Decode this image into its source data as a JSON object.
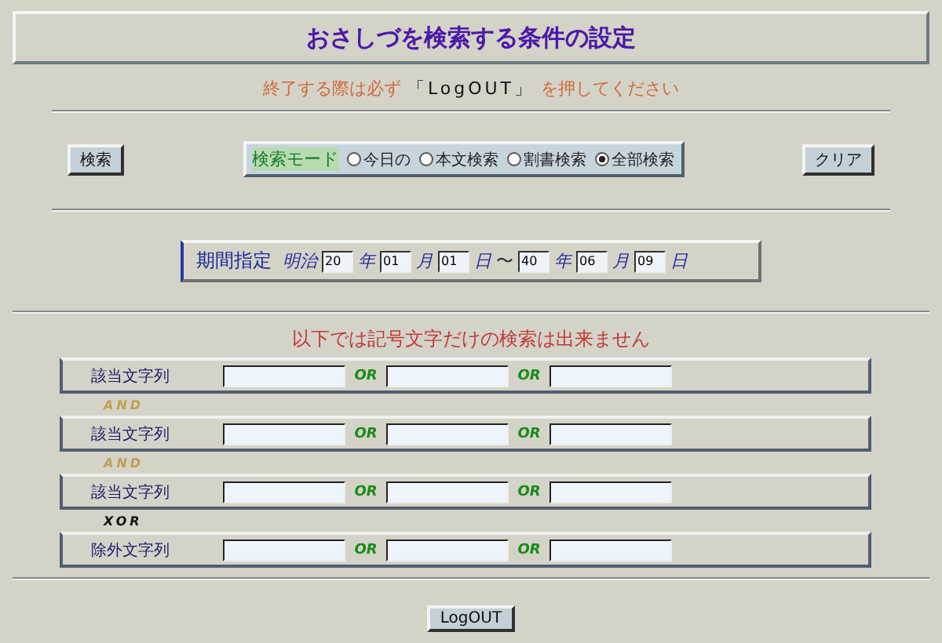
{
  "title": "おさしづを検索する条件の設定",
  "notice": {
    "before": "終了する際は必ず",
    "emphasis": "「LogOUT」",
    "after": "を押してください"
  },
  "search_button": "検索",
  "clear_button": "クリア",
  "mode": {
    "label": "検索モード",
    "options": [
      {
        "label": "今日の",
        "selected": false
      },
      {
        "label": "本文検索",
        "selected": false
      },
      {
        "label": "割書検索",
        "selected": false
      },
      {
        "label": "全部検索",
        "selected": true
      }
    ]
  },
  "period": {
    "label": "期間指定",
    "era": "明治",
    "parts": [
      {
        "kind": "field",
        "value": "20"
      },
      {
        "kind": "unit",
        "text": "年"
      },
      {
        "kind": "field",
        "value": "01"
      },
      {
        "kind": "unit",
        "text": "月"
      },
      {
        "kind": "field",
        "value": "01"
      },
      {
        "kind": "unit",
        "text": "日"
      },
      {
        "kind": "sep",
        "text": "〜"
      },
      {
        "kind": "field",
        "value": "40"
      },
      {
        "kind": "unit",
        "text": "年"
      },
      {
        "kind": "field",
        "value": "06"
      },
      {
        "kind": "unit",
        "text": "月"
      },
      {
        "kind": "field",
        "value": "09"
      },
      {
        "kind": "unit",
        "text": "日"
      }
    ]
  },
  "warning": "以下では記号文字だけの検索は出来ません",
  "rows": [
    {
      "label": "該当文字列",
      "or": [
        "OR",
        "OR"
      ],
      "after": "AND"
    },
    {
      "label": "該当文字列",
      "or": [
        "OR",
        "OR"
      ],
      "after": "AND"
    },
    {
      "label": "該当文字列",
      "or": [
        "OR",
        "OR"
      ],
      "after": "XOR"
    },
    {
      "label": "除外文字列",
      "or": [
        "OR",
        "OR"
      ]
    }
  ],
  "logout_button": "LogOUT"
}
